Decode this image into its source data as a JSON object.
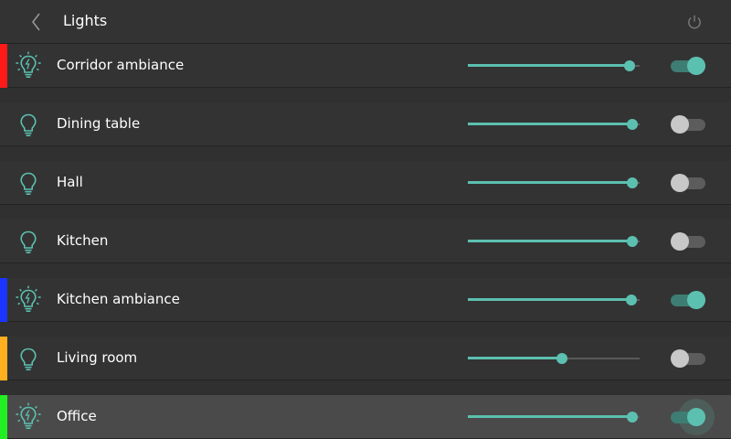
{
  "header": {
    "title": "Lights",
    "back_icon": "chevron-left-icon",
    "power_icon": "power-icon"
  },
  "colors": {
    "accent": "#5cc0b0",
    "toggle_off_knob": "#c8c8c8"
  },
  "lights": [
    {
      "label": "Corridor ambiance",
      "icon": "light-bulb-rays-icon",
      "color": "#ff1a1a",
      "brightness": 0.94,
      "on": true,
      "selected": false
    },
    {
      "label": "Dining table",
      "icon": "light-bulb-icon",
      "color": "",
      "brightness": 0.96,
      "on": false,
      "selected": false
    },
    {
      "label": "Hall",
      "icon": "light-bulb-icon",
      "color": "",
      "brightness": 0.96,
      "on": false,
      "selected": false
    },
    {
      "label": "Kitchen",
      "icon": "light-bulb-icon",
      "color": "",
      "brightness": 0.96,
      "on": false,
      "selected": false
    },
    {
      "label": "Kitchen ambiance",
      "icon": "light-bulb-rays-icon",
      "color": "#1a35ff",
      "brightness": 0.95,
      "on": true,
      "selected": false
    },
    {
      "label": "Living room",
      "icon": "light-bulb-icon",
      "color": "#ffb020",
      "brightness": 0.55,
      "on": false,
      "selected": false
    },
    {
      "label": "Office",
      "icon": "light-bulb-rays-icon",
      "color": "#22ee22",
      "brightness": 0.96,
      "on": true,
      "selected": true
    }
  ]
}
